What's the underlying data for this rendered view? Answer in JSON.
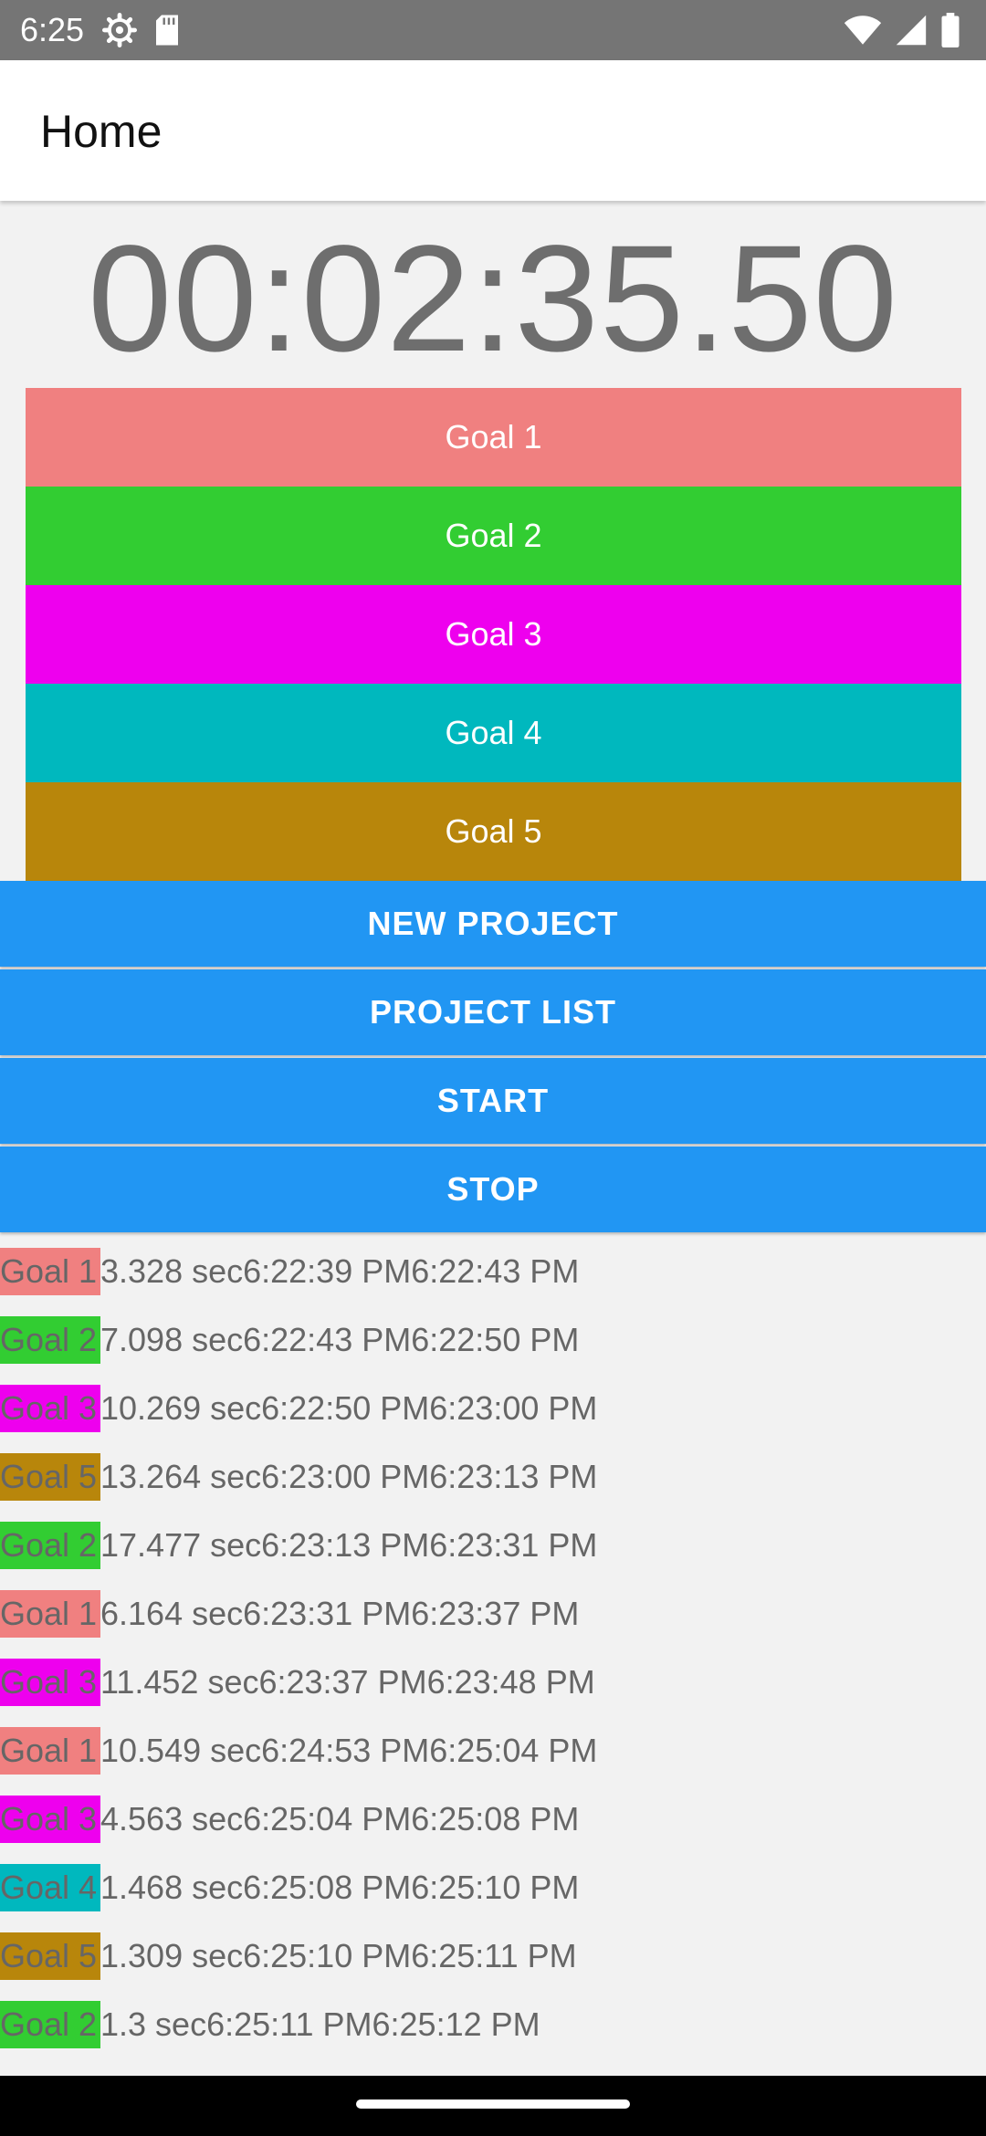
{
  "status_bar": {
    "time": "6:25",
    "left_icons": [
      "settings-icon",
      "sd-card-icon"
    ],
    "right_icons": [
      "wifi-icon",
      "signal-icon",
      "battery-icon"
    ]
  },
  "app_bar": {
    "title": "Home"
  },
  "timer": {
    "value": "00:02:35.50"
  },
  "goal_buttons": [
    {
      "label": "Goal 1",
      "color": "#f08080"
    },
    {
      "label": "Goal 2",
      "color": "#32cd32"
    },
    {
      "label": "Goal 3",
      "color": "#ee00ee"
    },
    {
      "label": "Goal 4",
      "color": "#00b8be"
    },
    {
      "label": "Goal 5",
      "color": "#b8860b"
    }
  ],
  "action_buttons": [
    {
      "label": "NEW PROJECT"
    },
    {
      "label": "PROJECT LIST"
    },
    {
      "label": "START"
    },
    {
      "label": "STOP"
    }
  ],
  "log": [
    {
      "goal": "Goal 1",
      "color": "#f08080",
      "details": "3.328 sec6:22:39 PM6:22:43 PM"
    },
    {
      "goal": "Goal 2",
      "color": "#32cd32",
      "details": "7.098 sec6:22:43 PM6:22:50 PM"
    },
    {
      "goal": "Goal 3",
      "color": "#ee00ee",
      "details": "10.269 sec6:22:50 PM6:23:00 PM"
    },
    {
      "goal": "Goal 5",
      "color": "#b8860b",
      "details": "13.264 sec6:23:00 PM6:23:13 PM"
    },
    {
      "goal": "Goal 2",
      "color": "#32cd32",
      "details": "17.477 sec6:23:13 PM6:23:31 PM"
    },
    {
      "goal": "Goal 1",
      "color": "#f08080",
      "details": "6.164 sec6:23:31 PM6:23:37 PM"
    },
    {
      "goal": "Goal 3",
      "color": "#ee00ee",
      "details": "11.452 sec6:23:37 PM6:23:48 PM"
    },
    {
      "goal": "Goal 1",
      "color": "#f08080",
      "details": "10.549 sec6:24:53 PM6:25:04 PM"
    },
    {
      "goal": "Goal 3",
      "color": "#ee00ee",
      "details": "4.563 sec6:25:04 PM6:25:08 PM"
    },
    {
      "goal": "Goal 4",
      "color": "#00b8be",
      "details": "1.468 sec6:25:08 PM6:25:10 PM"
    },
    {
      "goal": "Goal 5",
      "color": "#b8860b",
      "details": "1.309 sec6:25:10 PM6:25:11 PM"
    },
    {
      "goal": "Goal 2",
      "color": "#32cd32",
      "details": "1.3 sec6:25:11 PM6:25:12 PM"
    }
  ],
  "colors": {
    "status_bar": "#757575",
    "primary_button": "#2196f3",
    "background": "#f2f2f2",
    "timer_text": "#6e6e6e"
  }
}
